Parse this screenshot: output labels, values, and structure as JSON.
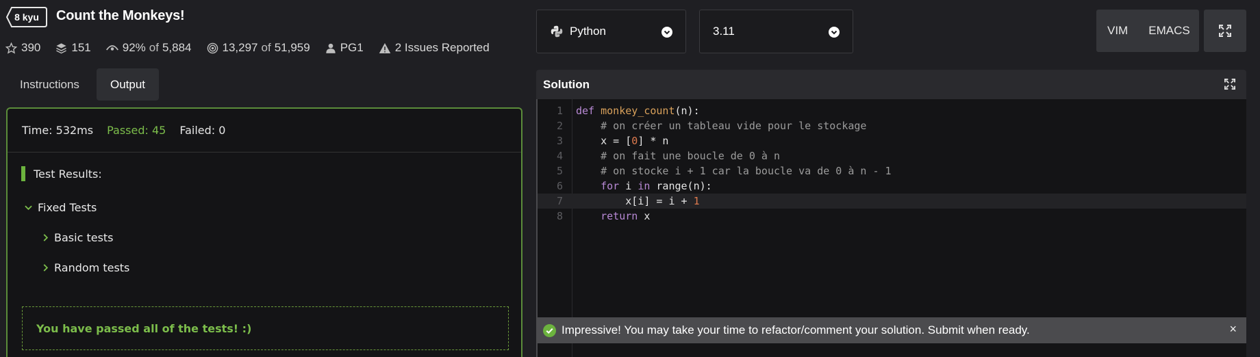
{
  "header": {
    "kyu": "8 kyu",
    "title": "Count the Monkeys!",
    "stats": {
      "stars": "390",
      "collections": "151",
      "satisfaction": "92%",
      "satisfaction_of": "of",
      "satisfaction_votes": "5,884",
      "completed": "13,297",
      "completed_of": "of",
      "attempted": "51,959",
      "author": "PG1",
      "issues": "2 Issues Reported"
    }
  },
  "tabs": [
    {
      "label": "Instructions",
      "active": false
    },
    {
      "label": "Output",
      "active": true
    }
  ],
  "output": {
    "time": "Time: 532ms",
    "passed": "Passed: 45",
    "failed": "Failed: 0",
    "results_title": "Test Results:",
    "groups": [
      {
        "label": "Fixed Tests",
        "expanded": true,
        "children": [
          "Basic tests",
          "Random tests"
        ]
      }
    ],
    "success_message": "You have passed all of the tests! :)"
  },
  "controls": {
    "language": "Python",
    "version": "3.11",
    "keymap_vim": "VIM",
    "keymap_emacs": "EMACS"
  },
  "solution": {
    "title": "Solution",
    "line_numbers": [
      "1",
      "2",
      "3",
      "4",
      "5",
      "6",
      "7",
      "8"
    ],
    "active_line": 7
  },
  "notice": {
    "message": "Impressive! You may take your time to refactor/comment your solution. Submit when ready.",
    "close": "×"
  },
  "colors": {
    "accent_green": "#6cb33e",
    "passed_text": "#7cbd4b",
    "background": "#1f1f23"
  },
  "icons": [
    "star-icon",
    "collection-icon",
    "eye-icon",
    "target-icon",
    "user-icon",
    "warning-icon",
    "python-icon",
    "chevron-down-icon",
    "fullscreen-icon",
    "expand-icon",
    "check-circle-icon",
    "close-icon"
  ]
}
